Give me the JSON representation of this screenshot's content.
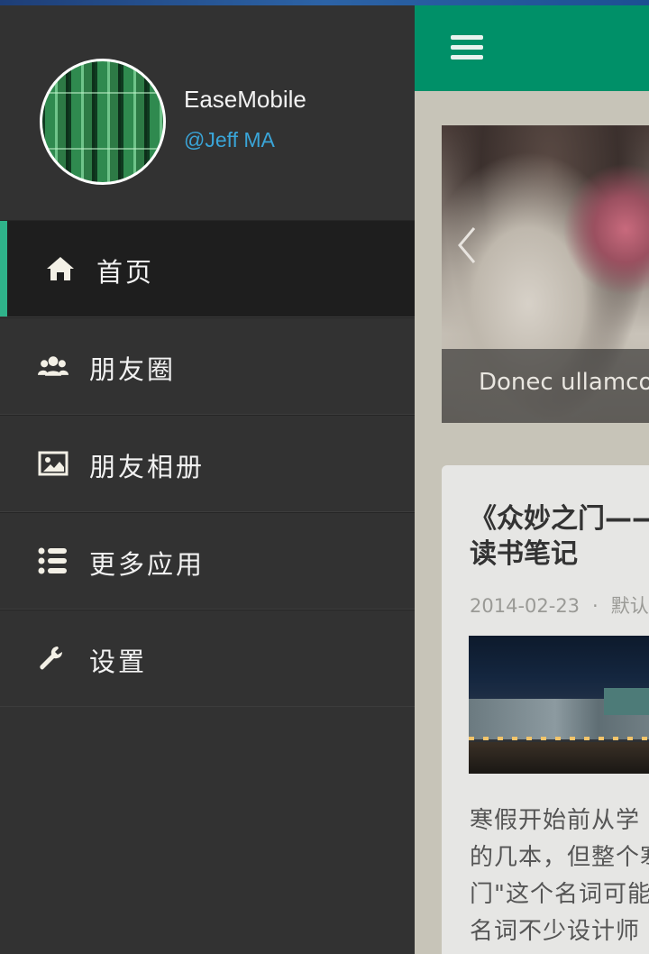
{
  "profile": {
    "name": "EaseMobile",
    "handle": "@Jeff MA"
  },
  "nav": {
    "items": [
      {
        "label": "首页",
        "icon": "home-icon",
        "active": true
      },
      {
        "label": "朋友圈",
        "icon": "users-icon",
        "active": false
      },
      {
        "label": "朋友相册",
        "icon": "photo-icon",
        "active": false
      },
      {
        "label": "更多应用",
        "icon": "list-icon",
        "active": false
      },
      {
        "label": "设置",
        "icon": "wrench-icon",
        "active": false
      }
    ]
  },
  "topbar": {
    "menu_icon": "hamburger-menu-icon",
    "color": "#009068"
  },
  "slider": {
    "caption": "Donec ullamcorper"
  },
  "post": {
    "title": "《众妙之门——\n读书笔记",
    "date": "2014-02-23",
    "separator": "·",
    "category": "默认",
    "excerpt": "寒假开始前从学\n的几本，但整个寒\n门\"这个名词可能\n名词不少设计师"
  },
  "colors": {
    "accent": "#2fb38a",
    "handle": "#3aa5d8",
    "drawer_bg": "#323232"
  }
}
